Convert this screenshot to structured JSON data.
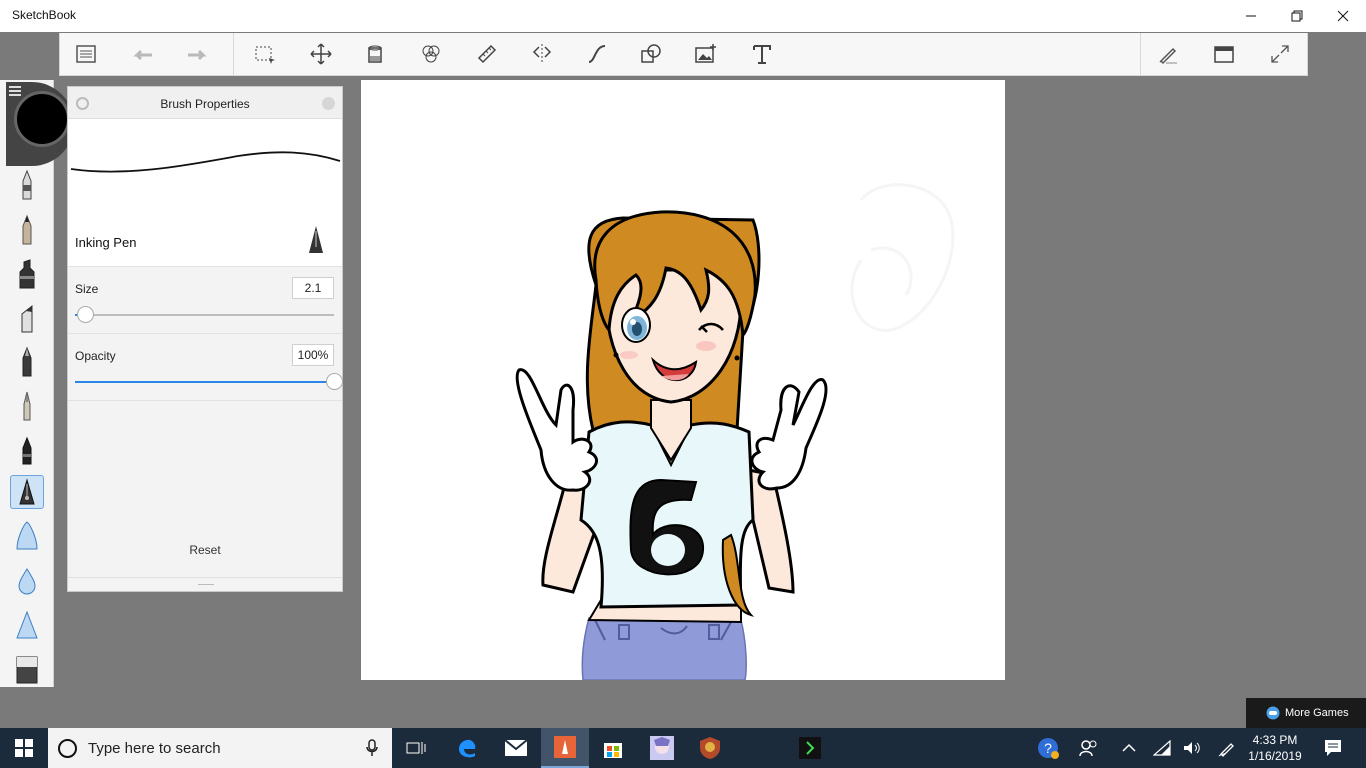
{
  "window": {
    "title": "SketchBook"
  },
  "toolbar": {
    "tools": [
      "lagoon-menu",
      "undo",
      "redo",
      "select",
      "transform",
      "fill",
      "color-editor",
      "ruler",
      "symmetry",
      "curve",
      "shape",
      "image",
      "text"
    ],
    "right_tools": [
      "pen-settings",
      "window-mode",
      "fullscreen"
    ]
  },
  "palette": {
    "brushes": [
      "airbrush",
      "pencil",
      "marker",
      "chisel-marker",
      "ballpoint-pen",
      "fine-brush",
      "technical-pen",
      "inking-pen",
      "blob",
      "drop",
      "smudge",
      "eraser"
    ],
    "active_index": 7,
    "current_color": "#000000"
  },
  "brush_properties": {
    "title": "Brush Properties",
    "brush_name": "Inking Pen",
    "size_label": "Size",
    "size_value": "2.1",
    "size_fraction": 0.04,
    "opacity_label": "Opacity",
    "opacity_value": "100%",
    "opacity_fraction": 1.0,
    "reset_label": "Reset"
  },
  "overlay": {
    "more_games": "More Games"
  },
  "taskbar": {
    "search_placeholder": "Type here to search",
    "time": "4:33 PM",
    "date": "1/16/2019"
  },
  "colors": {
    "accent": "#2a87e8",
    "hair": "#d08a22",
    "shirt": "#e8f7f9",
    "jeans": "#8f9ad8",
    "skin": "#fde8dc"
  }
}
